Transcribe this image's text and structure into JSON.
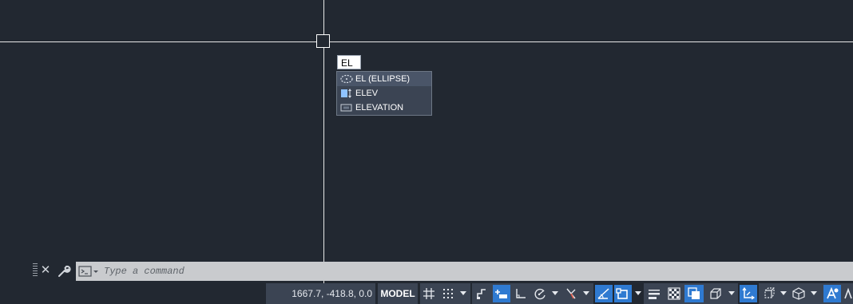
{
  "canvas": {
    "dynamic_input_value": "EL",
    "suggestions": [
      {
        "label": "EL (ELLIPSE)",
        "icon": "ellipse-icon"
      },
      {
        "label": "ELEV",
        "icon": "elev-icon"
      },
      {
        "label": "ELEVATION",
        "icon": "elevation-icon"
      }
    ]
  },
  "command_line": {
    "placeholder": "Type a command",
    "close_label": "✕"
  },
  "status_bar": {
    "coordinates": "1667.7, -418.8, 0.0",
    "model_label": "MODEL"
  },
  "colors": {
    "background": "#222831",
    "crosshair": "#e8e8e8",
    "toggle_on": "#2f7ad1",
    "panel": "#3b4453"
  }
}
